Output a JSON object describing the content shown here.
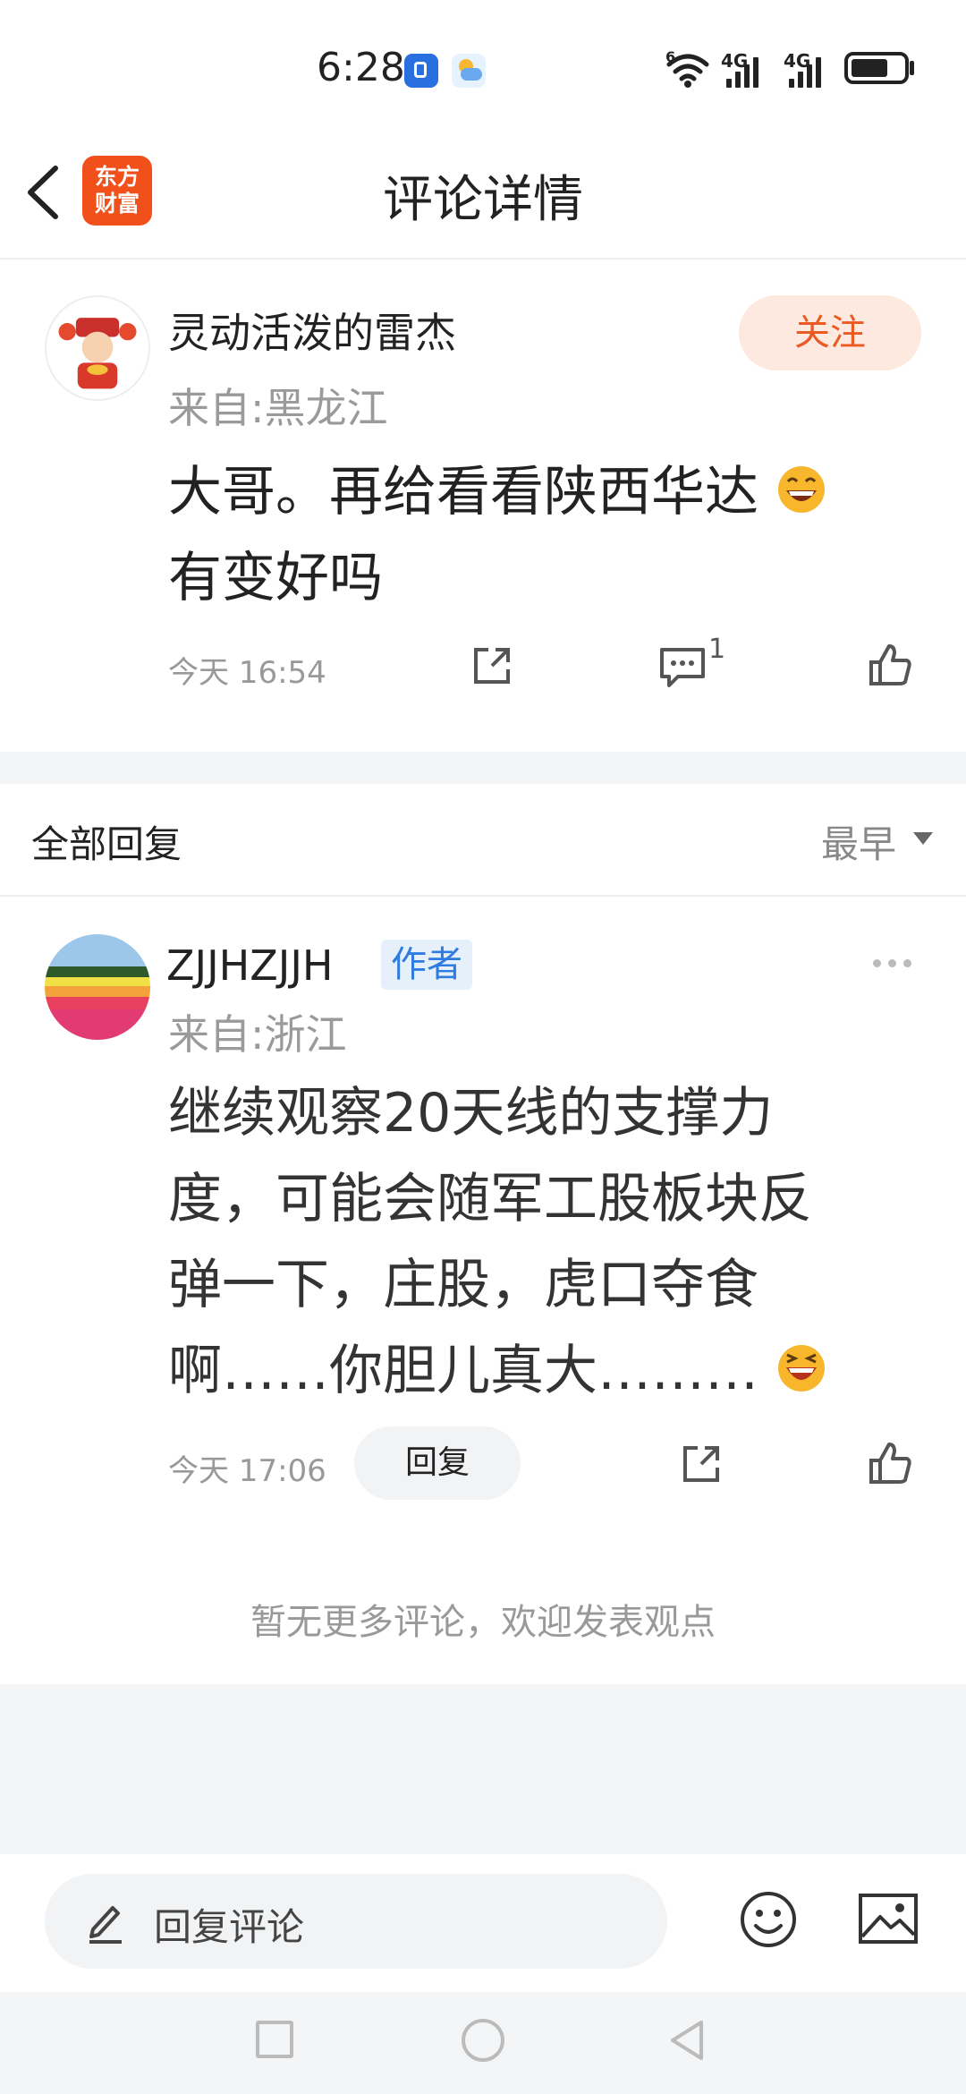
{
  "status_bar": {
    "time": "6:28",
    "signal_wifi_label": "6",
    "signal_1_label": "4G",
    "signal_2_label": "4G"
  },
  "header": {
    "title": "评论详情",
    "logo_line1": "东方",
    "logo_line2": "财富"
  },
  "comment": {
    "username": "灵动活泼的雷杰",
    "location": "来自:黑龙江",
    "follow_label": "关注",
    "text_line1": "大哥。再给看看陕西华达",
    "text_line2": "有变好吗",
    "time": "今天 16:54",
    "reply_count": "1"
  },
  "replies_section": {
    "title": "全部回复",
    "sort_label": "最早"
  },
  "reply": {
    "username": "ZJJHZJJH",
    "author_badge": "作者",
    "location": "来自:浙江",
    "text_line1": "继续观察20天线的支撑力",
    "text_line2": "度，可能会随军工股板块反",
    "text_line3": "弹一下，庄股，虎口夺食",
    "text_line4": "啊……你胆儿真大………",
    "time": "今天 17:06",
    "reply_label": "回复"
  },
  "no_more_text": "暂无更多评论，欢迎发表观点",
  "input_bar": {
    "placeholder": "回复评论"
  },
  "colors": {
    "accent": "#ea5a23",
    "follow_bg": "#fde9e0",
    "author_badge": "#2f7be0"
  },
  "icons": [
    "back-icon",
    "share-icon",
    "comment-icon",
    "like-icon",
    "more-icon",
    "edit-icon",
    "emoji-icon",
    "image-icon",
    "nav-square-icon",
    "nav-circle-icon",
    "nav-back-icon"
  ]
}
